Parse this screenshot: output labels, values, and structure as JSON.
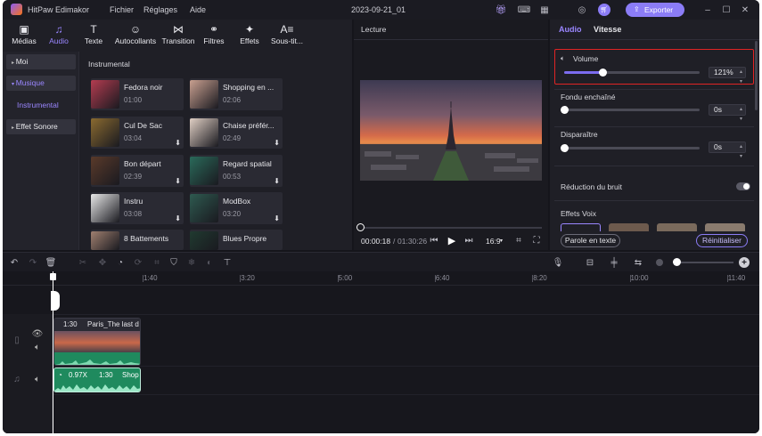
{
  "app": {
    "name": "HitPaw Edimakor",
    "project_title": "2023-09-21_01"
  },
  "menu": [
    "Fichier",
    "Réglages",
    "Aide"
  ],
  "titlebar": {
    "export_label": "Exporter"
  },
  "toolbar": {
    "tabs": [
      "Médias",
      "Audio",
      "Texte",
      "Autocollants",
      "Transition",
      "Filtres",
      "Effets",
      "Sous-tit..."
    ],
    "active": "Audio"
  },
  "sidebar": {
    "items": [
      "Moi",
      "Musique",
      "Instrumental",
      "Effet Sonore"
    ]
  },
  "library": {
    "section_title": "Instrumental",
    "items": [
      {
        "name": "Fedora noir",
        "duration": "01:00"
      },
      {
        "name": "Shopping en ...",
        "duration": "02:06"
      },
      {
        "name": "Cul De Sac",
        "duration": "03:04"
      },
      {
        "name": "Chaise préfér...",
        "duration": "02:49"
      },
      {
        "name": "Bon départ",
        "duration": "02:39"
      },
      {
        "name": "Regard spatial",
        "duration": "00:53"
      },
      {
        "name": "Instru",
        "duration": "03:08"
      },
      {
        "name": "ModBox",
        "duration": "03:20"
      },
      {
        "name": "8 Battements",
        "duration": ""
      },
      {
        "name": "Blues Propre",
        "duration": ""
      }
    ]
  },
  "preview": {
    "title": "Lecture",
    "current_time": "00:00:18",
    "total_time": "01:30:26",
    "aspect_ratio": "16:9",
    "progress": 0.0
  },
  "properties": {
    "tabs": [
      "Audio",
      "Vitesse"
    ],
    "volume": {
      "label": "Volume",
      "value": "121%",
      "level": 0.28
    },
    "fade_in": {
      "label": "Fondu enchaîné",
      "value": "0s",
      "level": 0
    },
    "fade_out": {
      "label": "Disparaître",
      "value": "0s",
      "level": 0
    },
    "noise_reduction": {
      "label": "Réduction du bruit"
    },
    "voice_effects": {
      "label": "Effets Voix"
    },
    "text_to_speech_label": "Parole en texte",
    "reset_label": "Réinitialiser"
  },
  "timeline": {
    "ticks": [
      "1:40",
      "3:20",
      "5:00",
      "6:40",
      "8:20",
      "10:00",
      "11:40"
    ],
    "video_clip": {
      "duration": "1:30",
      "title": "Paris_The last d"
    },
    "audio_clip": {
      "speed": "0.97X",
      "duration": "1:30",
      "title": "Shop"
    }
  },
  "colors": {
    "accent": "#7c6cf0",
    "export_button": "#8b7cf6",
    "highlight_border": "#e02424",
    "audio_clip": "#1f8a5e"
  }
}
